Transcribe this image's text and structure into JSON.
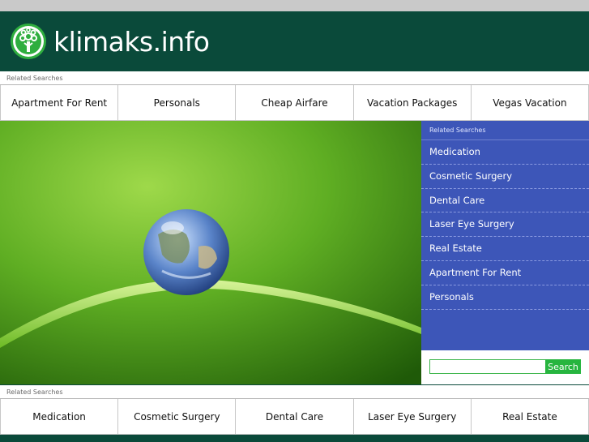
{
  "site": {
    "title": "klimaks.info",
    "logo_icon": "tree-icon",
    "brand_color": "#0a4a3a",
    "accent_color": "#2fae3f"
  },
  "top_links": {
    "label": "Related Searches",
    "items": [
      "Apartment For Rent",
      "Personals",
      "Cheap Airfare",
      "Vacation Packages",
      "Vegas Vacation"
    ]
  },
  "hero": {
    "image": "water-drop-earth-on-grass-blade"
  },
  "sidebar": {
    "label": "Related Searches",
    "items": [
      "Medication",
      "Cosmetic Surgery",
      "Dental Care",
      "Laser Eye Surgery",
      "Real Estate",
      "Apartment For Rent",
      "Personals"
    ],
    "color": "#3d56b8"
  },
  "search": {
    "value": "",
    "button_label": "Search"
  },
  "bottom_links": {
    "label": "Related Searches",
    "items": [
      "Medication",
      "Cosmetic Surgery",
      "Dental Care",
      "Laser Eye Surgery",
      "Real Estate"
    ]
  }
}
